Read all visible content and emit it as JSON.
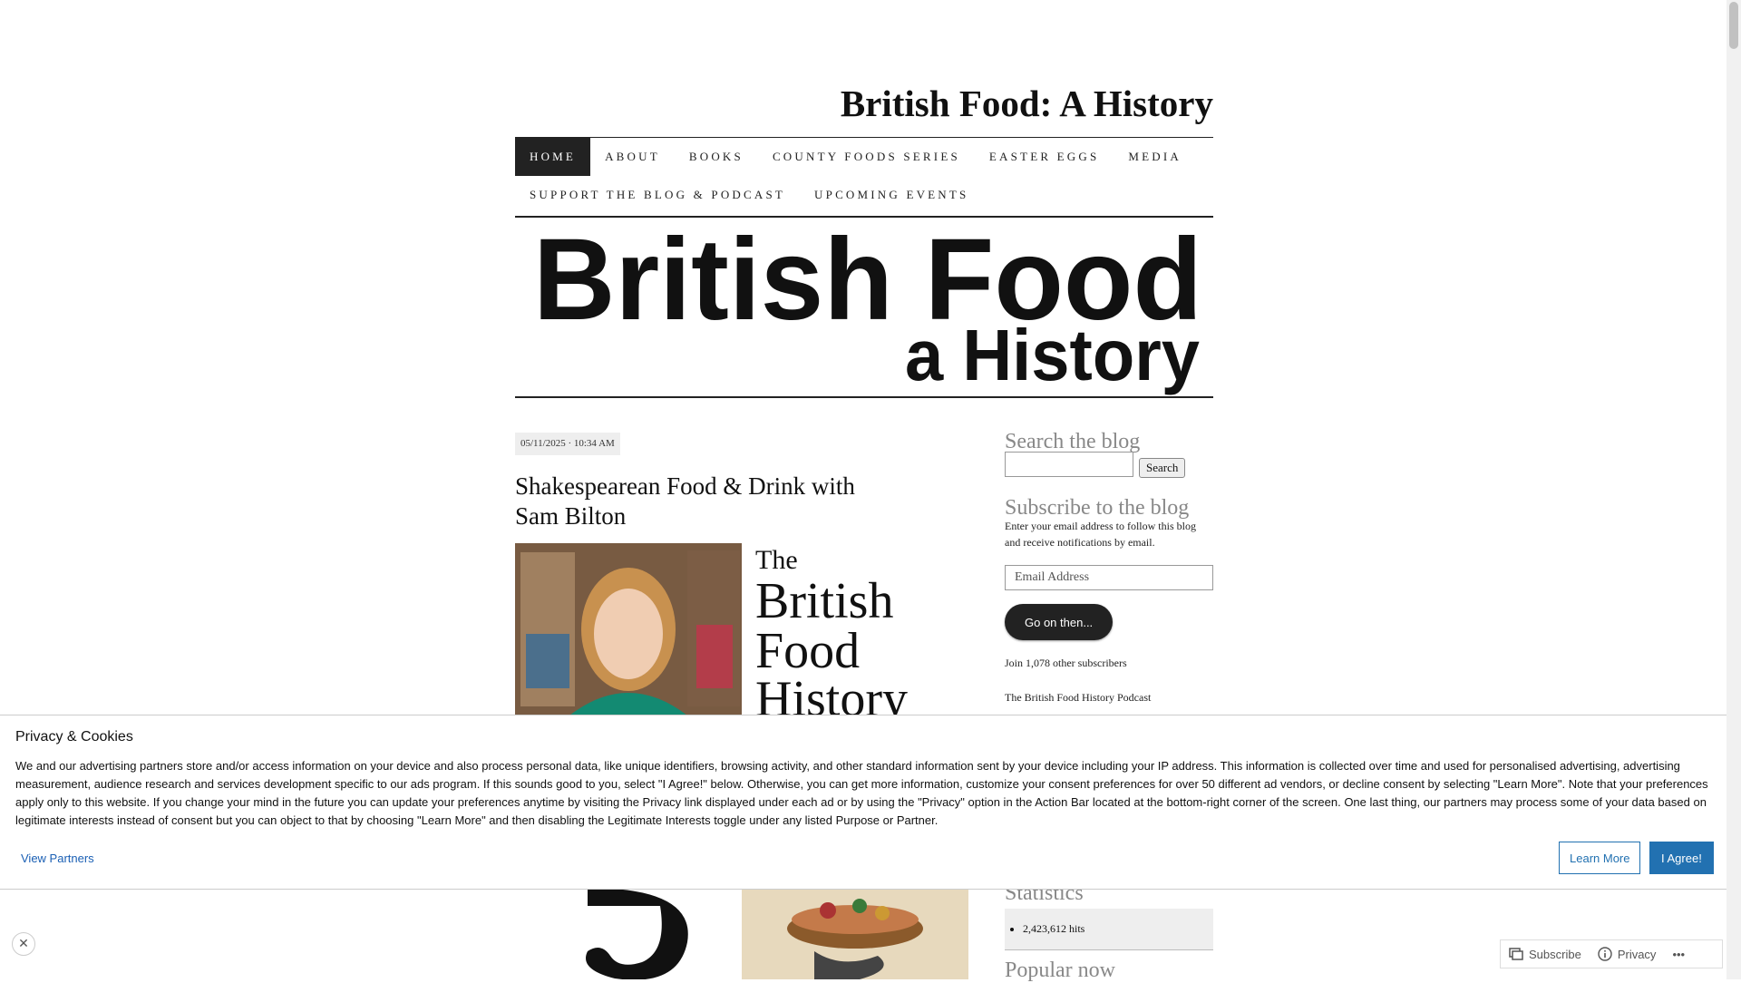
{
  "site": {
    "title": "British Food: A History"
  },
  "nav": {
    "row1": [
      "HOME",
      "ABOUT",
      "BOOKS",
      "COUNTY FOODS SERIES",
      "EASTER EGGS",
      "MEDIA"
    ],
    "row2": [
      "SUPPORT THE BLOG & PODCAST",
      "UPCOMING EVENTS"
    ],
    "active": "HOME"
  },
  "banner": {
    "line1": "British Food",
    "line2": "a History"
  },
  "post": {
    "date": "05/11/2025 · 10:34 AM",
    "title_line1": "Shakespearean Food & Drink with",
    "title_line2": "Sam Bilton",
    "image_text": [
      "The",
      "British",
      "Food",
      "History"
    ]
  },
  "sidebar": {
    "search_heading": "Search the blog",
    "search_button": "Search",
    "subscribe_heading": "Subscribe to the blog",
    "subscribe_text_line1": "Enter your email address to follow this blog",
    "subscribe_text_line2": "and receive notifications by email.",
    "email_placeholder": "Email Address",
    "go_button": "Go on then...",
    "subscribers": "Join 1,078 other subscribers",
    "podcast_link": "The British Food History Podcast",
    "stats_heading": "Statistics",
    "hits": "2,423,612 hits",
    "popular_heading": "Popular now"
  },
  "cookie": {
    "title": "Privacy & Cookies",
    "body": "We and our advertising partners store and/or access information on your device and also process personal data, like unique identifiers, browsing activity, and other standard information sent by your device including your IP address. This information is collected over time and used for personalised advertising, advertising measurement, audience research and services development specific to our ads program. If this sounds good to you, select \"I Agree!\" below. Otherwise, you can get more information, customize your consent preferences for over 50 different ad vendors, or decline consent by selecting \"Learn More\". Note that your preferences apply only to this website. If you change your mind in the future you can update your preferences anytime by visiting the Privacy link displayed under each ad or by using the \"Privacy\" option in the Action Bar located at the bottom-right corner of the screen. One last thing, our partners may process some of your data based on legitimate interests instead of consent but you can object to that by choosing \"Learn More\" and then disabling the Legitimate Interests toggle under any listed Purpose or Partner.",
    "view_partners": "View Partners",
    "learn_more": "Learn More",
    "agree": "I Agree!"
  },
  "action_bar": {
    "subscribe": "Subscribe",
    "privacy": "Privacy",
    "more": "•••"
  },
  "close_glyph": "✕",
  "colors": {
    "accent": "#2271b1",
    "nav_active_bg": "#222222",
    "sidebar_heading": "#888888"
  },
  "icons": [
    "close-icon",
    "subscribe-icon",
    "privacy-info-icon",
    "more-icon"
  ]
}
